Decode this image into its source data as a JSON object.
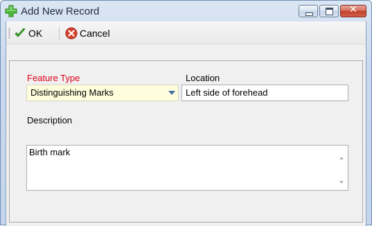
{
  "window": {
    "title": "Add New Record",
    "title_icon": "green-plus-icon"
  },
  "title_buttons": {
    "minimize_icon": "minimize-icon",
    "maximize_icon": "maximize-icon",
    "close_glyph": "✕"
  },
  "toolbar": {
    "ok_label": "OK",
    "ok_icon": "green-checkmark-icon",
    "cancel_label": "Cancel",
    "cancel_icon": "red-x-circle-icon"
  },
  "form": {
    "feature_type": {
      "label": "Feature Type",
      "label_color": "#e0001a",
      "value": "Distinguishing Marks"
    },
    "location": {
      "label": "Location",
      "value": "Left side of forehead"
    },
    "description": {
      "label": "Description",
      "value": "Birth mark"
    }
  },
  "colors": {
    "required_label": "#e0001a",
    "combo_background": "#fefedd",
    "title_gradient": "#c9d9ee"
  }
}
